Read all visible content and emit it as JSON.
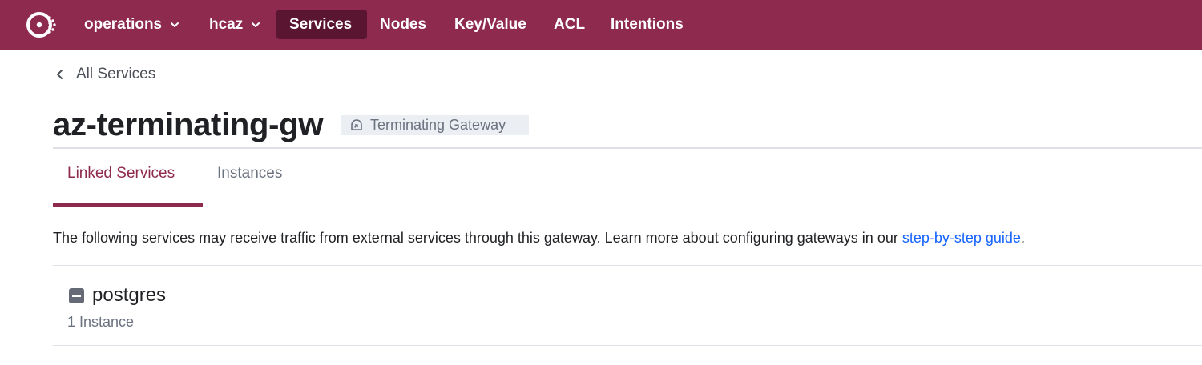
{
  "topnav": {
    "brand_icon": "consul-logo-icon",
    "items": [
      {
        "label": "operations",
        "dropdown": true,
        "active": false
      },
      {
        "label": "hcaz",
        "dropdown": true,
        "active": false
      },
      {
        "label": "Services",
        "dropdown": false,
        "active": true
      },
      {
        "label": "Nodes",
        "dropdown": false,
        "active": false
      },
      {
        "label": "Key/Value",
        "dropdown": false,
        "active": false
      },
      {
        "label": "ACL",
        "dropdown": false,
        "active": false
      },
      {
        "label": "Intentions",
        "dropdown": false,
        "active": false
      }
    ]
  },
  "breadcrumb": {
    "label": "All Services",
    "icon": "chevron-left-icon"
  },
  "header": {
    "title": "az-terminating-gw",
    "badge": {
      "label": "Terminating Gateway",
      "icon": "gateway-icon"
    }
  },
  "tabs": [
    {
      "label": "Linked Services",
      "active": true
    },
    {
      "label": "Instances",
      "active": false
    }
  ],
  "notice": {
    "text": "The following services may receive traffic from external services through this gateway. Learn more about configuring gateways in our ",
    "link": "step-by-step guide",
    "suffix": "."
  },
  "services": [
    {
      "name": "postgres",
      "instances": "1 Instance",
      "icon": "service-icon"
    }
  ],
  "colors": {
    "brand": "#8e2a4e",
    "brand_active": "#5a1631",
    "link": "#1563ff",
    "muted": "#6b7280"
  }
}
